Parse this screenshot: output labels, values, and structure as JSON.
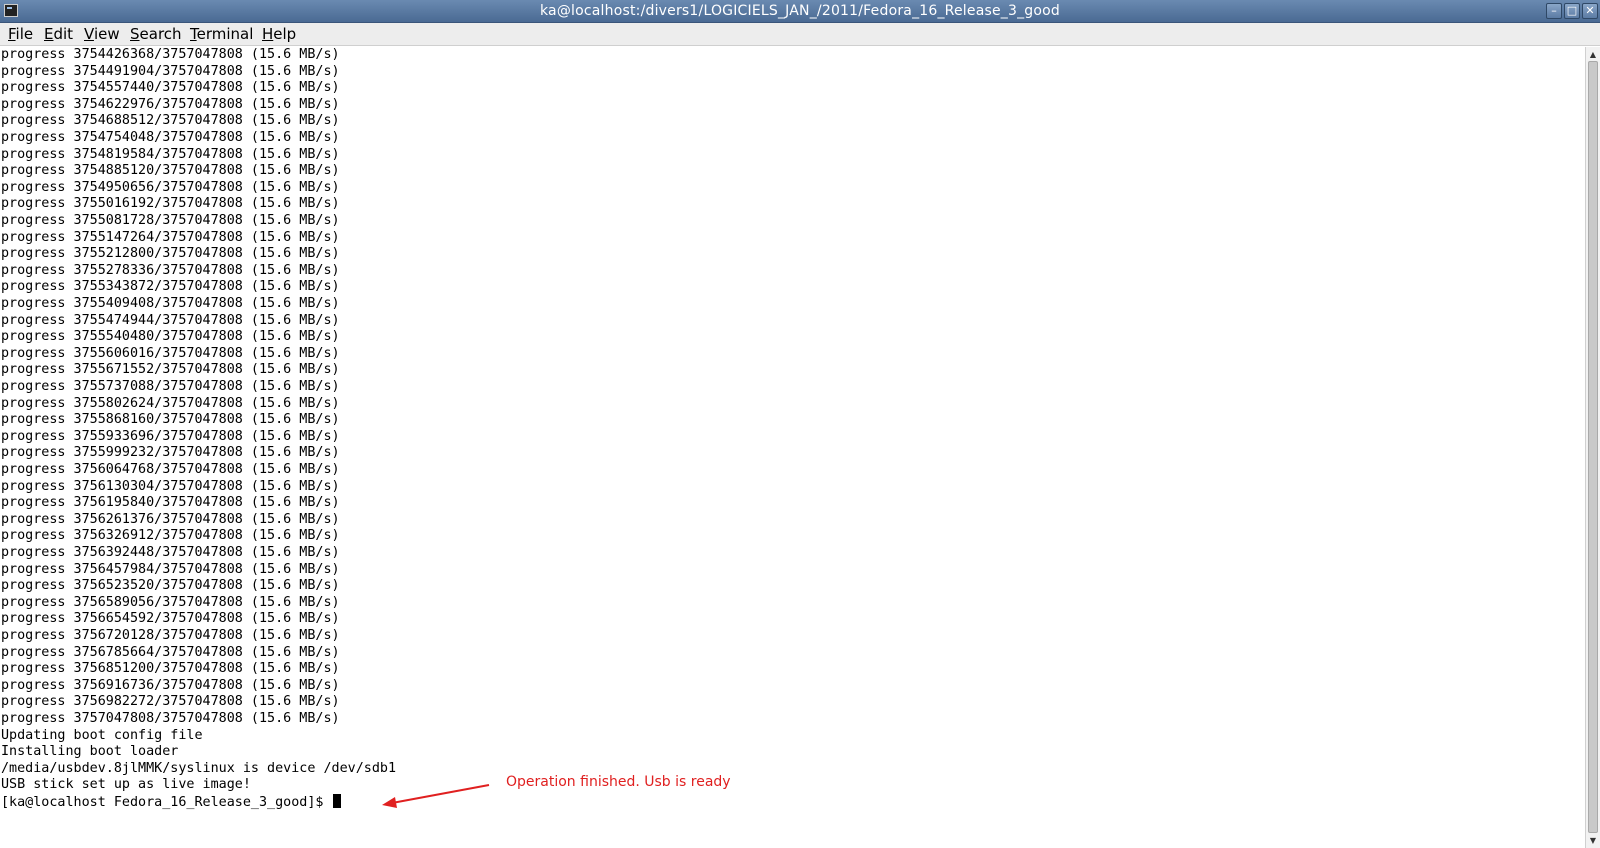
{
  "window": {
    "title": "ka@localhost:/divers1/LOGICIELS_JAN_/2011/Fedora_16_Release_3_good",
    "icon": "terminal-icon",
    "controls": {
      "minimize": "–",
      "maximize": "□",
      "close": "✕"
    }
  },
  "menu": {
    "items": [
      {
        "label": "File",
        "mnemonic": "F",
        "rest": "ile"
      },
      {
        "label": "Edit",
        "mnemonic": "E",
        "rest": "dit"
      },
      {
        "label": "View",
        "mnemonic": "V",
        "rest": "iew"
      },
      {
        "label": "Search",
        "mnemonic": "S",
        "rest": "earch"
      },
      {
        "label": "Terminal",
        "mnemonic": "T",
        "rest": "erminal"
      },
      {
        "label": "Help",
        "mnemonic": "H",
        "rest": "elp"
      }
    ]
  },
  "terminal": {
    "lines": [
      "progress 3754426368/3757047808 (15.6 MB/s)",
      "progress 3754491904/3757047808 (15.6 MB/s)",
      "progress 3754557440/3757047808 (15.6 MB/s)",
      "progress 3754622976/3757047808 (15.6 MB/s)",
      "progress 3754688512/3757047808 (15.6 MB/s)",
      "progress 3754754048/3757047808 (15.6 MB/s)",
      "progress 3754819584/3757047808 (15.6 MB/s)",
      "progress 3754885120/3757047808 (15.6 MB/s)",
      "progress 3754950656/3757047808 (15.6 MB/s)",
      "progress 3755016192/3757047808 (15.6 MB/s)",
      "progress 3755081728/3757047808 (15.6 MB/s)",
      "progress 3755147264/3757047808 (15.6 MB/s)",
      "progress 3755212800/3757047808 (15.6 MB/s)",
      "progress 3755278336/3757047808 (15.6 MB/s)",
      "progress 3755343872/3757047808 (15.6 MB/s)",
      "progress 3755409408/3757047808 (15.6 MB/s)",
      "progress 3755474944/3757047808 (15.6 MB/s)",
      "progress 3755540480/3757047808 (15.6 MB/s)",
      "progress 3755606016/3757047808 (15.6 MB/s)",
      "progress 3755671552/3757047808 (15.6 MB/s)",
      "progress 3755737088/3757047808 (15.6 MB/s)",
      "progress 3755802624/3757047808 (15.6 MB/s)",
      "progress 3755868160/3757047808 (15.6 MB/s)",
      "progress 3755933696/3757047808 (15.6 MB/s)",
      "progress 3755999232/3757047808 (15.6 MB/s)",
      "progress 3756064768/3757047808 (15.6 MB/s)",
      "progress 3756130304/3757047808 (15.6 MB/s)",
      "progress 3756195840/3757047808 (15.6 MB/s)",
      "progress 3756261376/3757047808 (15.6 MB/s)",
      "progress 3756326912/3757047808 (15.6 MB/s)",
      "progress 3756392448/3757047808 (15.6 MB/s)",
      "progress 3756457984/3757047808 (15.6 MB/s)",
      "progress 3756523520/3757047808 (15.6 MB/s)",
      "progress 3756589056/3757047808 (15.6 MB/s)",
      "progress 3756654592/3757047808 (15.6 MB/s)",
      "progress 3756720128/3757047808 (15.6 MB/s)",
      "progress 3756785664/3757047808 (15.6 MB/s)",
      "progress 3756851200/3757047808 (15.6 MB/s)",
      "progress 3756916736/3757047808 (15.6 MB/s)",
      "progress 3756982272/3757047808 (15.6 MB/s)",
      "progress 3757047808/3757047808 (15.6 MB/s)",
      "Updating boot config file",
      "Installing boot loader",
      "/media/usbdev.8jlMMK/syslinux is device /dev/sdb1",
      "USB stick set up as live image!"
    ],
    "prompt": "[ka@localhost Fedora_16_Release_3_good]$ "
  },
  "annotation": {
    "text": "Operation finished. Usb is ready",
    "color": "#e02020"
  },
  "scrollbar": {
    "up": "▲",
    "down": "▼"
  }
}
